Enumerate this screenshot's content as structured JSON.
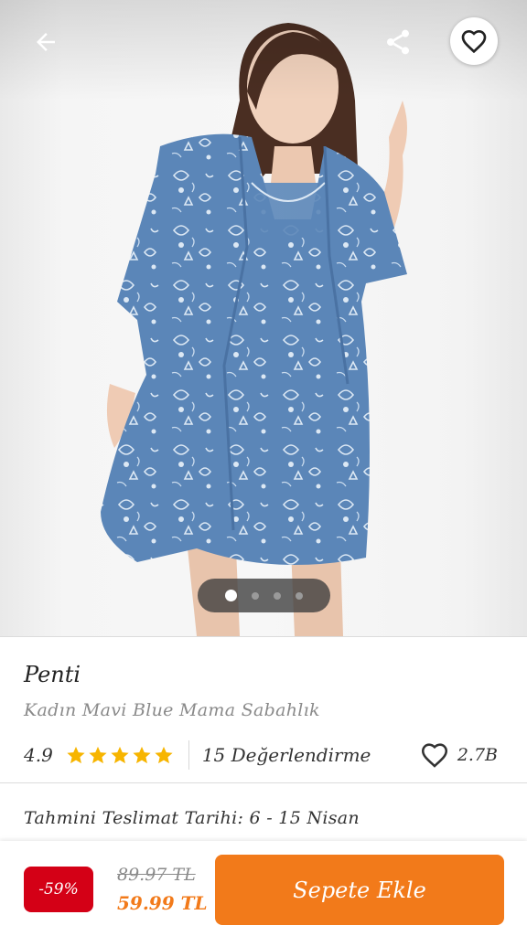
{
  "hero": {
    "image_alt": "Woman wearing blue floral robe",
    "page_count": 4,
    "active_page": 0
  },
  "nav": {
    "back_icon": "arrow-left-icon",
    "share_icon": "share-icon",
    "favorite_icon": "heart-outline-icon"
  },
  "product": {
    "brand": "Penti",
    "name": "Kadın Mavi Blue Mama Sabahlık",
    "rating": "4.9",
    "stars": 5,
    "review_count_label": "15 Değerlendirme",
    "favorite_count": "2.7B"
  },
  "delivery": {
    "label": "Tahmini Teslimat Tarihi: 6 - 15 Nisan"
  },
  "bottom": {
    "discount": "-59%",
    "old_price": "89.97 TL",
    "new_price": "59.99 TL",
    "cart_label": "Sepete Ekle"
  },
  "colors": {
    "accent": "#f27a1a",
    "discount": "#d40016",
    "star": "#f7b500",
    "robe": "#5b86b8"
  }
}
